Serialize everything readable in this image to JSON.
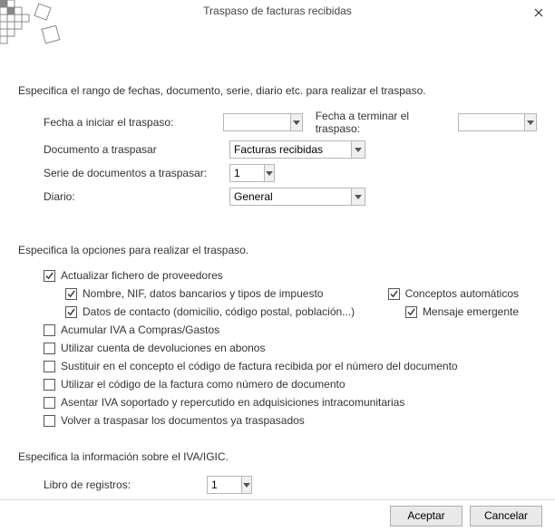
{
  "title": "Traspaso de facturas recibidas",
  "section1": {
    "heading": "Especifica el rango de fechas, documento, serie, diario etc. para realizar el traspaso.",
    "start_label": "Fecha a iniciar el traspaso:",
    "start_value": "",
    "end_label": "Fecha a terminar el traspaso:",
    "end_value": "",
    "doc_label": "Documento a traspasar",
    "doc_value": "Facturas recibidas",
    "serie_label": "Serie de documentos a traspasar:",
    "serie_value": "1",
    "diario_label": "Diario:",
    "diario_value": "General"
  },
  "section2": {
    "heading": "Especifica la opciones para realizar el traspaso.",
    "update": "Actualizar fichero de proveedores",
    "sub1": "Nombre, NIF, datos bancarios y tipos de impuesto",
    "sub2": "Datos de contacto (domicilio, código postal, población...)",
    "right1": "Conceptos automáticos",
    "right2": "Mensaje emergente",
    "c1": "Acumular IVA a Compras/Gastos",
    "c2": "Utilizar cuenta de devoluciones en abonos",
    "c3": "Sustituir en el concepto el código de factura recibida por el número del documento",
    "c4": "Utilizar el código de la factura como número de documento",
    "c5": "Asentar IVA soportado y repercutido en adquisiciones intracomunitarias",
    "c6": "Volver a traspasar los documentos ya traspasados"
  },
  "section3": {
    "heading": "Especifica la información sobre el IVA/IGIC.",
    "libro_label": "Libro de registros:",
    "libro_value": "1"
  },
  "buttons": {
    "ok": "Aceptar",
    "cancel": "Cancelar"
  }
}
